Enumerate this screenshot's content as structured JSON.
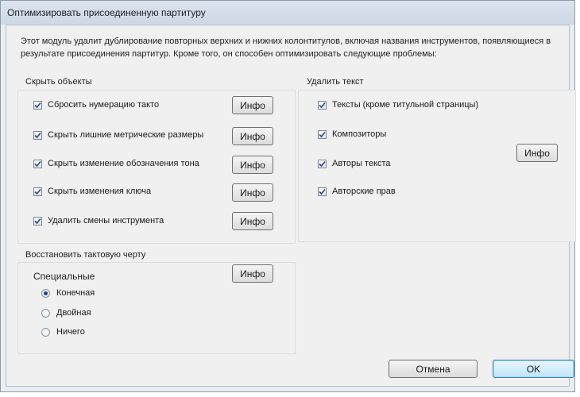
{
  "window": {
    "title": "Оптимизировать присоединенную партитуру",
    "description": "Этот модуль удалит дублирование повторных верхних и нижних колонтитулов, включая названия инструментов, появляющиеся в результате присоединения партитур. Кроме того, он способен оптимизировать следующие проблемы:"
  },
  "hide_objects": {
    "label": "Скрыть объекты",
    "items": [
      {
        "label": "Сбросить нумерацию такто",
        "checked": true,
        "info": "Инфо"
      },
      {
        "label": "Скрыть лишние метрические размеры",
        "checked": true,
        "info": "Инфо"
      },
      {
        "label": "Скрыть изменение обозначения тона",
        "checked": true,
        "info": "Инфо"
      },
      {
        "label": "Скрыть изменения ключа",
        "checked": true,
        "info": "Инфо"
      },
      {
        "label": "Удалить смены инструмента",
        "checked": true,
        "info": "Инфо"
      }
    ]
  },
  "delete_text": {
    "label": "Удалить текст",
    "items": [
      {
        "label": "Тексты (кроме титульной страницы)",
        "checked": true
      },
      {
        "label": "Композиторы",
        "checked": true
      },
      {
        "label": "Авторы текста",
        "checked": true
      },
      {
        "label": "Авторские прав",
        "checked": true
      }
    ],
    "info": "Инфо"
  },
  "restore_barline": {
    "label": "Восстановить тактовую черту",
    "special_label": "Специальные",
    "info": "Инфо",
    "options": [
      {
        "label": "Конечная",
        "selected": true
      },
      {
        "label": "Двойная",
        "selected": false
      },
      {
        "label": "Ничего",
        "selected": false
      }
    ]
  },
  "footer": {
    "cancel": "Отмена",
    "ok": "OK"
  },
  "colors": {
    "check_mark": "#2b4a8c",
    "radio_dot": "#1f3f8c",
    "ok_border": "#3c7fb1"
  }
}
